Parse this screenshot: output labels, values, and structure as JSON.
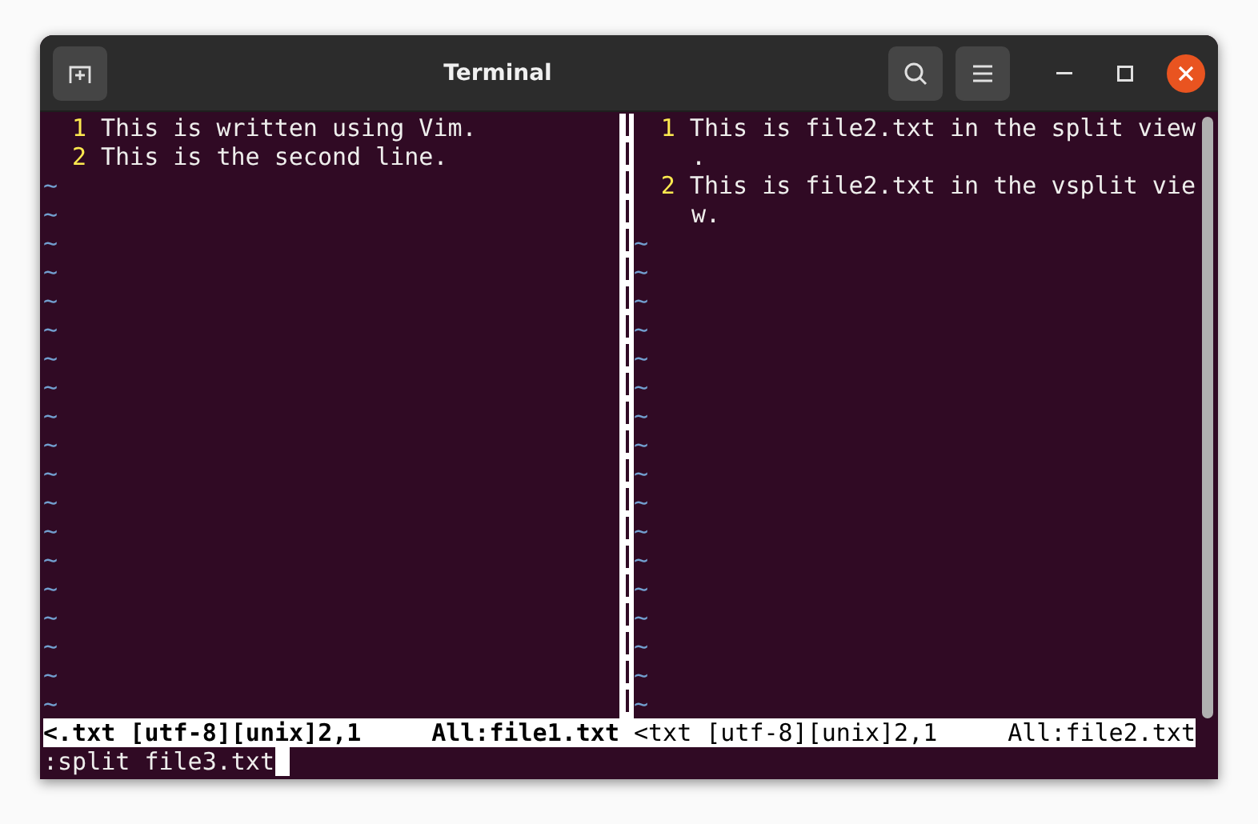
{
  "window": {
    "title": "Terminal"
  },
  "panes": [
    {
      "lines": [
        {
          "number": "1",
          "rows": [
            "This is written using Vim."
          ]
        },
        {
          "number": "2",
          "rows": [
            "This is the second line."
          ]
        }
      ],
      "filler": [
        "~",
        "~",
        "~",
        "~",
        "~",
        "~",
        "~",
        "~",
        "~",
        "~",
        "~",
        "~",
        "~",
        "~",
        "~",
        "~",
        "~",
        "~",
        "~"
      ],
      "status": {
        "file": "<.txt [utf-8][unix]2,1",
        "position": "All:file1.txt",
        "active": true
      }
    },
    {
      "lines": [
        {
          "number": "1",
          "rows": [
            "This is file2.txt in the split view",
            "."
          ]
        },
        {
          "number": "2",
          "rows": [
            "This is file2.txt in the vsplit vie",
            "w."
          ]
        }
      ],
      "filler": [
        "~",
        "~",
        "~",
        "~",
        "~",
        "~",
        "~",
        "~",
        "~",
        "~",
        "~",
        "~",
        "~",
        "~",
        "~",
        "~",
        "~"
      ],
      "status": {
        "file": "<txt [utf-8][unix]2,1",
        "position": "All:file2.txt",
        "active": false
      }
    }
  ],
  "command_line": {
    "text": ":split file3.txt",
    "cursor": true
  }
}
